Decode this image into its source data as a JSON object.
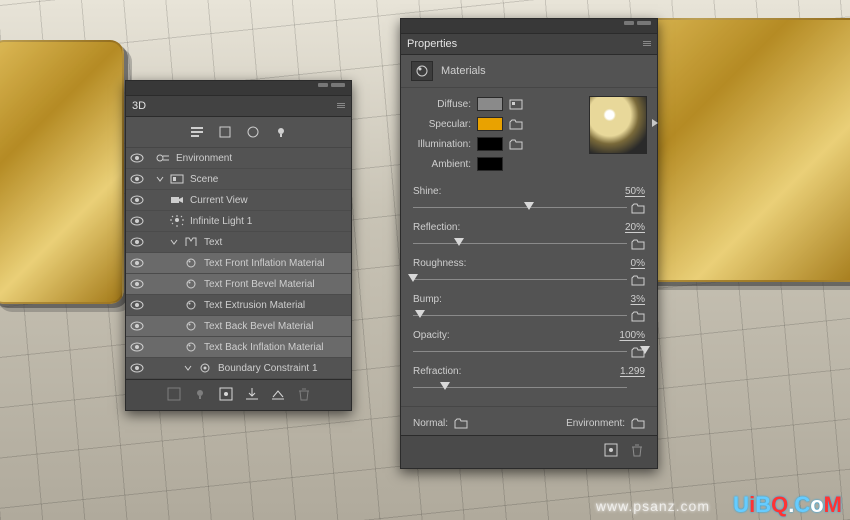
{
  "panels": {
    "threeD": {
      "title": "3D",
      "toolbar_icons": [
        "filter-whole-scene",
        "mesh-icon",
        "material-icon",
        "light-icon"
      ],
      "tree": [
        {
          "id": "env",
          "icon": "env-icon",
          "label": "Environment",
          "sel": false,
          "depth": 0,
          "twisty": false
        },
        {
          "id": "scene",
          "icon": "scene-icon",
          "label": "Scene",
          "sel": false,
          "depth": 0,
          "twisty": true
        },
        {
          "id": "view",
          "icon": "camera-icon",
          "label": "Current View",
          "sel": false,
          "depth": 1,
          "twisty": false
        },
        {
          "id": "light",
          "icon": "light-icon",
          "label": "Infinite Light 1",
          "sel": false,
          "depth": 1,
          "twisty": false
        },
        {
          "id": "text",
          "icon": "mesh-icon",
          "label": "Text",
          "sel": false,
          "depth": 1,
          "twisty": true
        },
        {
          "id": "mfi",
          "icon": "material-icon",
          "label": "Text Front Inflation Material",
          "sel": true,
          "depth": 2,
          "twisty": false
        },
        {
          "id": "mfb",
          "icon": "material-icon",
          "label": "Text Front Bevel Material",
          "sel": true,
          "depth": 2,
          "twisty": false
        },
        {
          "id": "mex",
          "icon": "material-icon",
          "label": "Text Extrusion Material",
          "sel": false,
          "depth": 2,
          "twisty": false
        },
        {
          "id": "mbb",
          "icon": "material-icon",
          "label": "Text Back Bevel Material",
          "sel": true,
          "depth": 2,
          "twisty": false
        },
        {
          "id": "mbi",
          "icon": "material-icon",
          "label": "Text Back Inflation Material",
          "sel": true,
          "depth": 2,
          "twisty": false
        },
        {
          "id": "bc",
          "icon": "constraint-icon",
          "label": "Boundary Constraint 1",
          "sel": false,
          "depth": 2,
          "twisty": true
        }
      ],
      "bottom_icons": [
        "add-icon",
        "light-toggle-icon",
        "render-icon",
        "plane-icon",
        "ground-icon",
        "trash-icon"
      ]
    },
    "properties": {
      "title": "Properties",
      "section": "Materials",
      "swatches": {
        "diffuse": {
          "label": "Diffuse:",
          "color": "#8a8a8a",
          "hasTexture": true
        },
        "specular": {
          "label": "Specular:",
          "color": "#e9a200",
          "hasTexture": false
        },
        "illumination": {
          "label": "Illumination:",
          "color": "#000000",
          "hasTexture": false
        },
        "ambient": {
          "label": "Ambient:",
          "color": "#000000",
          "hasTexture": false
        }
      },
      "sliders": {
        "shine": {
          "label": "Shine:",
          "value": "50%",
          "pos": 0.5,
          "folder": true
        },
        "reflection": {
          "label": "Reflection:",
          "value": "20%",
          "pos": 0.2,
          "folder": true
        },
        "roughness": {
          "label": "Roughness:",
          "value": "0%",
          "pos": 0.0,
          "folder": true
        },
        "bump": {
          "label": "Bump:",
          "value": "3%",
          "pos": 0.03,
          "folder": true
        },
        "opacity": {
          "label": "Opacity:",
          "value": "100%",
          "pos": 1.0,
          "folder": true
        },
        "refraction": {
          "label": "Refraction:",
          "value": "1.299",
          "pos": 0.14,
          "folder": false
        }
      },
      "normal_label": "Normal:",
      "environment_label": "Environment:",
      "footer_icons": [
        "render-settings-icon",
        "trash-icon"
      ]
    }
  },
  "watermark": "www.psanz.com",
  "logo": {
    "text": "UiBQ.CoM"
  }
}
